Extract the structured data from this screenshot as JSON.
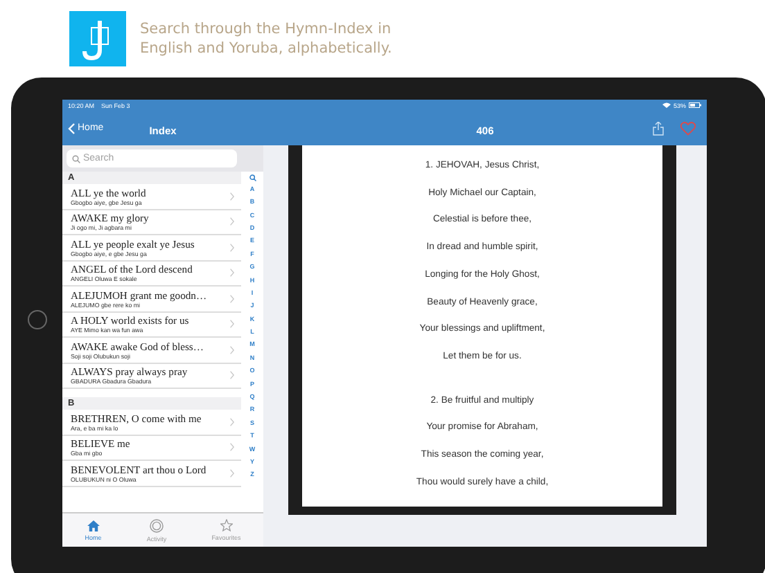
{
  "caption": "Search through the Hymn-Index in\nEnglish and Yoruba, alphabetically.",
  "status_bar": {
    "time": "10:20 AM",
    "date": "Sun Feb 3",
    "battery": "53%"
  },
  "index_pane": {
    "back": "Home",
    "title": "Index",
    "search": {
      "placeholder": "Search"
    },
    "sections": [
      {
        "header": "A",
        "rows": [
          {
            "title": "ALL ye the world",
            "subtitle": "Gbogbo aiye, gbe Jesu ga"
          },
          {
            "title": "AWAKE my glory",
            "subtitle": "Ji ogo mi, Ji agbara mi"
          },
          {
            "title": "ALL ye people exalt ye Jesus",
            "subtitle": "Gbogbo aiye, e gbe Jesu ga"
          },
          {
            "title": "ANGEL of the Lord descend",
            "subtitle": "ANGELI Oluwa E sokale"
          },
          {
            "title": "ALEJUMOH grant me goodn…",
            "subtitle": "ALEJUMO gbe rere ko mi"
          },
          {
            "title": "A HOLY world exists for us",
            "subtitle": "AYE Mimo kan wa fun awa"
          },
          {
            "title": "AWAKE awake God of bless…",
            "subtitle": "Soji soji Olubukun soji"
          },
          {
            "title": "ALWAYS pray always pray",
            "subtitle": "GBADURA Gbadura Gbadura"
          }
        ]
      },
      {
        "header": "B",
        "rows": [
          {
            "title": "BRETHREN, O come with me",
            "subtitle": "Ara, e ba mi ka lo"
          },
          {
            "title": "BELIEVE me",
            "subtitle": "Gba mi gbo"
          },
          {
            "title": "BENEVOLENT art thou o Lord",
            "subtitle": "OLUBUKUN ni O Oluwa"
          }
        ]
      }
    ],
    "index_letters": [
      "A",
      "B",
      "C",
      "D",
      "E",
      "F",
      "G",
      "H",
      "I",
      "J",
      "K",
      "L",
      "M",
      "N",
      "O",
      "P",
      "Q",
      "R",
      "S",
      "T",
      "W",
      "Y",
      "Z"
    ],
    "tabs": [
      {
        "label": "Home",
        "kind": "house",
        "selected": true
      },
      {
        "label": "Activity",
        "kind": "target",
        "selected": false
      },
      {
        "label": "Favourites",
        "kind": "star",
        "selected": false
      }
    ]
  },
  "hymn_pane": {
    "title": "406",
    "favourite": false,
    "stanzas": [
      [
        "1.  JEHOVAH, Jesus Christ,",
        "Holy Michael our Captain,",
        "Celestial is before thee,",
        "In dread and humble spirit,",
        "Longing for the Holy Ghost,",
        "Beauty of Heavenly grace,",
        "Your blessings and upliftment,",
        "Let them be for us."
      ],
      [
        "2.  Be fruitful and multiply",
        "Your promise for Abraham,",
        "This season the coming year,",
        "Thou would surely have a child,"
      ]
    ]
  }
}
